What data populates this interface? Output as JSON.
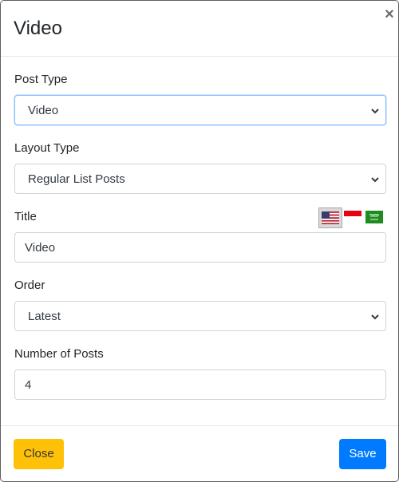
{
  "modal": {
    "title": "Video",
    "close_glyph": "×"
  },
  "form": {
    "post_type": {
      "label": "Post Type",
      "selected": "Video"
    },
    "layout_type": {
      "label": "Layout Type",
      "selected": "Regular List Posts"
    },
    "title": {
      "label": "Title",
      "value": "Video"
    },
    "order": {
      "label": "Order",
      "selected": "Latest"
    },
    "number_of_posts": {
      "label": "Number of Posts",
      "value": "4"
    }
  },
  "language_flags": [
    {
      "icon": "us-flag-icon",
      "selected": true
    },
    {
      "icon": "indonesia-flag-icon",
      "selected": false
    },
    {
      "icon": "saudi-arabia-flag-icon",
      "selected": false
    }
  ],
  "footer": {
    "close_label": "Close",
    "save_label": "Save"
  },
  "colors": {
    "close_button": "#ffc107",
    "save_button": "#007bff",
    "focus_border": "#80bdff"
  }
}
